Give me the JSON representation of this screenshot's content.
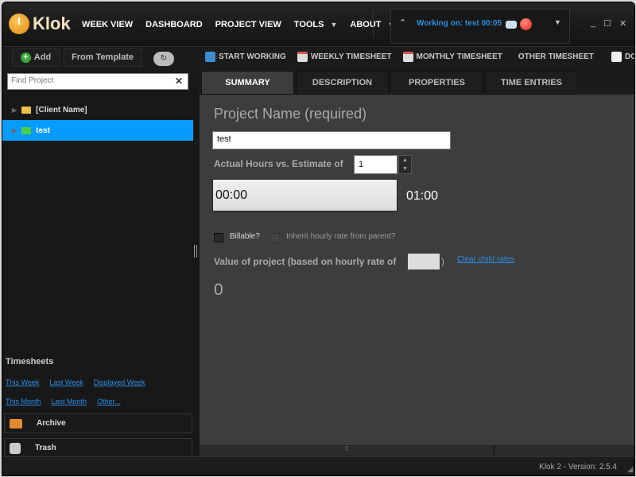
{
  "app": {
    "name": "Klok",
    "version": "Klok 2 - Version: 2.5.4"
  },
  "nav": [
    {
      "label": "WEEK VIEW"
    },
    {
      "label": "DASHBOARD"
    },
    {
      "label": "PROJECT VIEW"
    },
    {
      "label": "TOOLS"
    },
    {
      "label": "ABOUT"
    }
  ],
  "working": {
    "text": "Working on: test 00:05"
  },
  "sidebar": {
    "add_label": "Add",
    "template_label": "From Template",
    "search_placeholder": "Find Project",
    "tree": [
      {
        "label": "[Client Name]",
        "color": "#f0c040"
      },
      {
        "label": "test",
        "color": "#4cd04c",
        "selected": true
      }
    ],
    "timesheets_title": "Timesheets",
    "links_row1": [
      "This Week",
      "Last Week",
      "Displayed Week"
    ],
    "links_row2": [
      "This Month",
      "Last Month",
      "Other..."
    ],
    "archive_label": "Archive",
    "trash_label": "Trash"
  },
  "toolbar": [
    {
      "label": "START WORKING"
    },
    {
      "label": "WEEKLY TIMESHEET"
    },
    {
      "label": "MONTHLY TIMESHEET"
    },
    {
      "label": "OTHER TIMESHEET"
    },
    {
      "label": "DOWNL"
    }
  ],
  "tabs": [
    {
      "label": "SUMMARY",
      "active": true
    },
    {
      "label": "DESCRIPTION"
    },
    {
      "label": "PROPERTIES"
    },
    {
      "label": "TIME ENTRIES"
    }
  ],
  "summary": {
    "project_name_label": "Project Name (required)",
    "project_name_value": "test",
    "estimate_label": "Actual Hours vs. Estimate of",
    "estimate_value": "1",
    "actual_time": "00:00",
    "estimate_time": "01:00",
    "actual_progress": 0,
    "billable_label": "Billable?",
    "billable_checked": false,
    "inherit_label": "Inherit hourly rate from parent?",
    "inherit_checked": false,
    "value_label": "Value of project (based on hourly rate of",
    "rate_value": "",
    "close_paren": ")",
    "clear_link": "Clear child rates",
    "value": "0"
  },
  "colors": {
    "accent": "#079bff",
    "link": "#2a8ee8",
    "working_text": "#2a8fe0"
  }
}
